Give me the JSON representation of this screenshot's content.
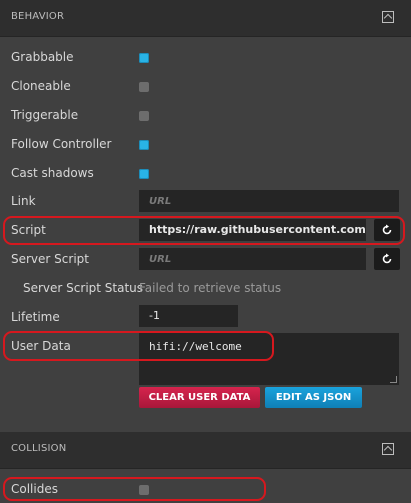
{
  "behavior": {
    "title": "BEHAVIOR",
    "grabbable": {
      "label": "Grabbable",
      "checked": true
    },
    "cloneable": {
      "label": "Cloneable",
      "checked": false
    },
    "triggerable": {
      "label": "Triggerable",
      "checked": false
    },
    "follow_controller": {
      "label": "Follow Controller",
      "checked": true
    },
    "cast_shadows": {
      "label": "Cast shadows",
      "checked": true
    },
    "link": {
      "label": "Link",
      "placeholder": "URL"
    },
    "script": {
      "label": "Script",
      "value": "https://raw.githubusercontent.com/h"
    },
    "server_script": {
      "label": "Server Script",
      "placeholder": "URL"
    },
    "server_script_status": {
      "label": "Server Script Status",
      "value": "Failed to retrieve status"
    },
    "lifetime": {
      "label": "Lifetime",
      "value": "-1"
    },
    "user_data": {
      "label": "User Data",
      "value": "hifi://welcome"
    },
    "clear_user_data_label": "CLEAR USER DATA",
    "edit_as_json_label": "EDIT AS JSON"
  },
  "collision": {
    "title": "COLLISION",
    "collides": {
      "label": "Collides",
      "checked": false
    }
  },
  "colors": {
    "accent_blue": "#29b3e6",
    "accent_red": "#d6244d",
    "highlight": "#d6181e"
  }
}
